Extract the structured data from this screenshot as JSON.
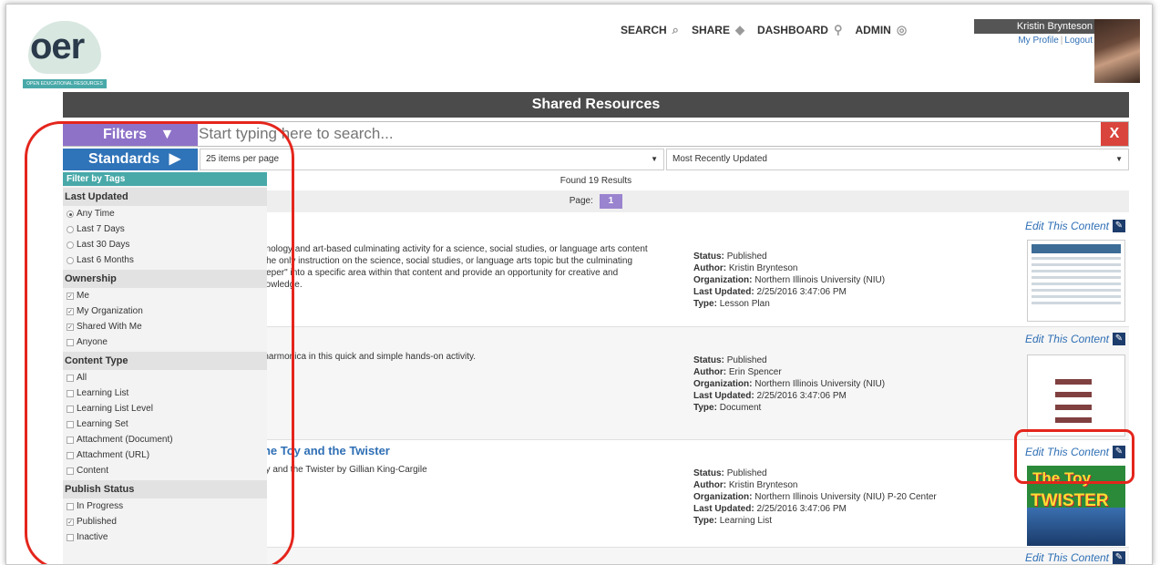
{
  "header": {
    "logo_text": "oer",
    "logo_band": "OPEN EDUCATIONAL RESOURCES",
    "nav": [
      {
        "label": "SEARCH",
        "icon": "search-icon"
      },
      {
        "label": "SHARE",
        "icon": "share-icon"
      },
      {
        "label": "DASHBOARD",
        "icon": "dashboard-icon"
      },
      {
        "label": "ADMIN",
        "icon": "admin-icon"
      }
    ],
    "user": {
      "name": "Kristin Brynteson",
      "profile_link": "My Profile",
      "logout_link": "Logout"
    }
  },
  "page_title": "Shared Resources",
  "search": {
    "filters_label": "Filters",
    "standards_label": "Standards",
    "placeholder": "Start typing here to search...",
    "clear_label": "X"
  },
  "per_page": "25 items per page",
  "sort": "Most Recently Updated",
  "found": "Found 19 Results",
  "pagination": {
    "label": "Page:",
    "current": "1"
  },
  "filter_panel": {
    "title": "Filter by Tags",
    "sections": [
      {
        "name": "Last Updated",
        "type": "radio",
        "options": [
          {
            "label": "Any Time",
            "checked": true
          },
          {
            "label": "Last 7 Days",
            "checked": false
          },
          {
            "label": "Last 30 Days",
            "checked": false
          },
          {
            "label": "Last 6 Months",
            "checked": false
          }
        ]
      },
      {
        "name": "Ownership",
        "type": "check",
        "options": [
          {
            "label": "Me",
            "checked": true
          },
          {
            "label": "My Organization",
            "checked": true
          },
          {
            "label": "Shared With Me",
            "checked": true
          },
          {
            "label": "Anyone",
            "checked": false
          }
        ]
      },
      {
        "name": "Content Type",
        "type": "check",
        "options": [
          {
            "label": "All",
            "checked": false
          },
          {
            "label": "Learning List",
            "checked": false
          },
          {
            "label": "Learning List Level",
            "checked": false
          },
          {
            "label": "Learning Set",
            "checked": false
          },
          {
            "label": "Attachment (Document)",
            "checked": false
          },
          {
            "label": "Attachment (URL)",
            "checked": false
          },
          {
            "label": "Content",
            "checked": false
          }
        ]
      },
      {
        "name": "Publish Status",
        "type": "check",
        "options": [
          {
            "label": "In Progress",
            "checked": false
          },
          {
            "label": "Published",
            "checked": true
          },
          {
            "label": "Inactive",
            "checked": false
          }
        ]
      }
    ]
  },
  "results": [
    {
      "title": "",
      "desc_lines": [
        "chnology and art-based culminating activity for a science, social studies, or language arts content",
        "e the only instruction on the science, social studies, or language arts topic but the culminating",
        "deeper\" into a specific area within that content and provide an opportunity for creative and",
        "knowledge."
      ],
      "status": "Published",
      "author": "Kristin Brynteson",
      "organization": "Northern Illinois University (NIU)",
      "updated": "2/25/2016 3:47:06 PM",
      "type": "Lesson Plan",
      "edit": "Edit This Content"
    },
    {
      "title": "",
      "desc_lines": [
        "n harmonica in this quick and simple hands-on activity."
      ],
      "status": "Published",
      "author": "Erin Spencer",
      "organization": "Northern Illinois University (NIU)",
      "updated": "2/25/2016 3:47:06 PM",
      "type": "Document",
      "edit": "Edit This Content"
    },
    {
      "title": "The Toy and the Twister",
      "desc_lines": [
        "Toy and the Twister by Gillian King-Cargile"
      ],
      "status": "Published",
      "author": "Kristin Brynteson",
      "organization": "Northern Illinois University (NIU) P-20 Center",
      "updated": "2/25/2016 3:47:06 PM",
      "type": "Learning List",
      "edit": "Edit This Content",
      "thumb_line1": "The Toy",
      "thumb_line2": "TWISTER"
    },
    {
      "edit": "Edit This Content"
    }
  ],
  "labels": {
    "status": "Status:",
    "author": "Author:",
    "organization": "Organization:",
    "updated": "Last Updated:",
    "type": "Type:"
  },
  "colors": {
    "filters": "#8e72c8",
    "standards": "#2f73b8",
    "clear": "#d9443c",
    "tags_head": "#49a9a9",
    "annotation": "#e4251c"
  }
}
